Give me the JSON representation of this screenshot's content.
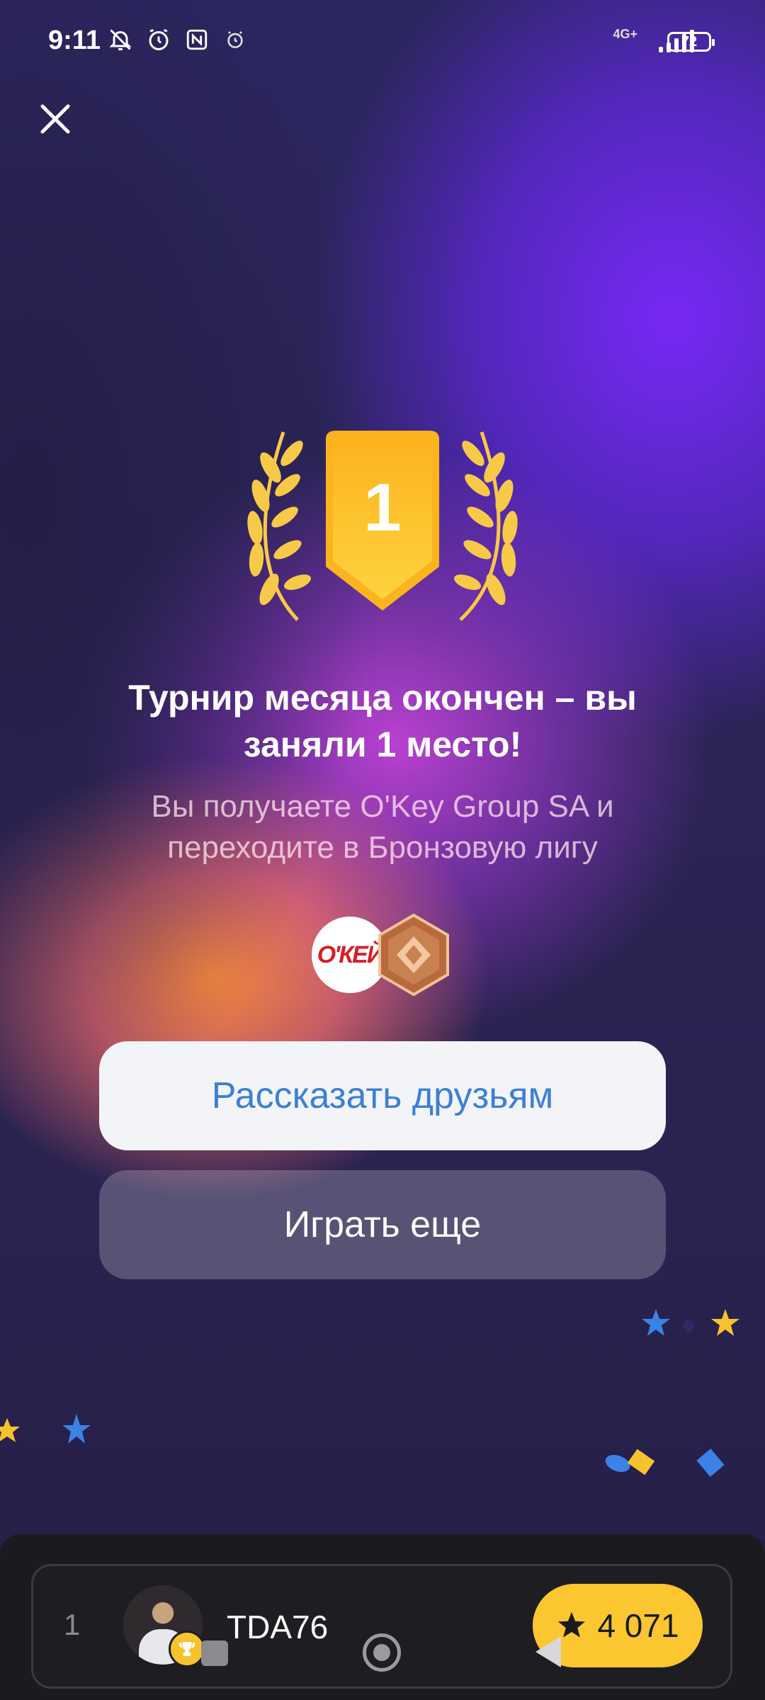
{
  "status_bar": {
    "time": "9:11",
    "network": "4G+",
    "battery": "72"
  },
  "award": {
    "place": "1"
  },
  "message": {
    "title": "Турнир месяца окончен – вы заняли 1 место!",
    "subtitle": "Вы получаете O'Key Group SA и переходите в Бронзовую лигу"
  },
  "rewards": {
    "brand_logo_text": "O'КЕЙ",
    "league_icon": "bronze-league-icon"
  },
  "buttons": {
    "share": "Рассказать друзьям",
    "play_again": "Играть еще"
  },
  "leaderboard_row": {
    "rank": "1",
    "username": "TDA76",
    "score": "4 071"
  },
  "colors": {
    "accent_gold": "#fcc630",
    "share_text": "#3c7fd6"
  }
}
